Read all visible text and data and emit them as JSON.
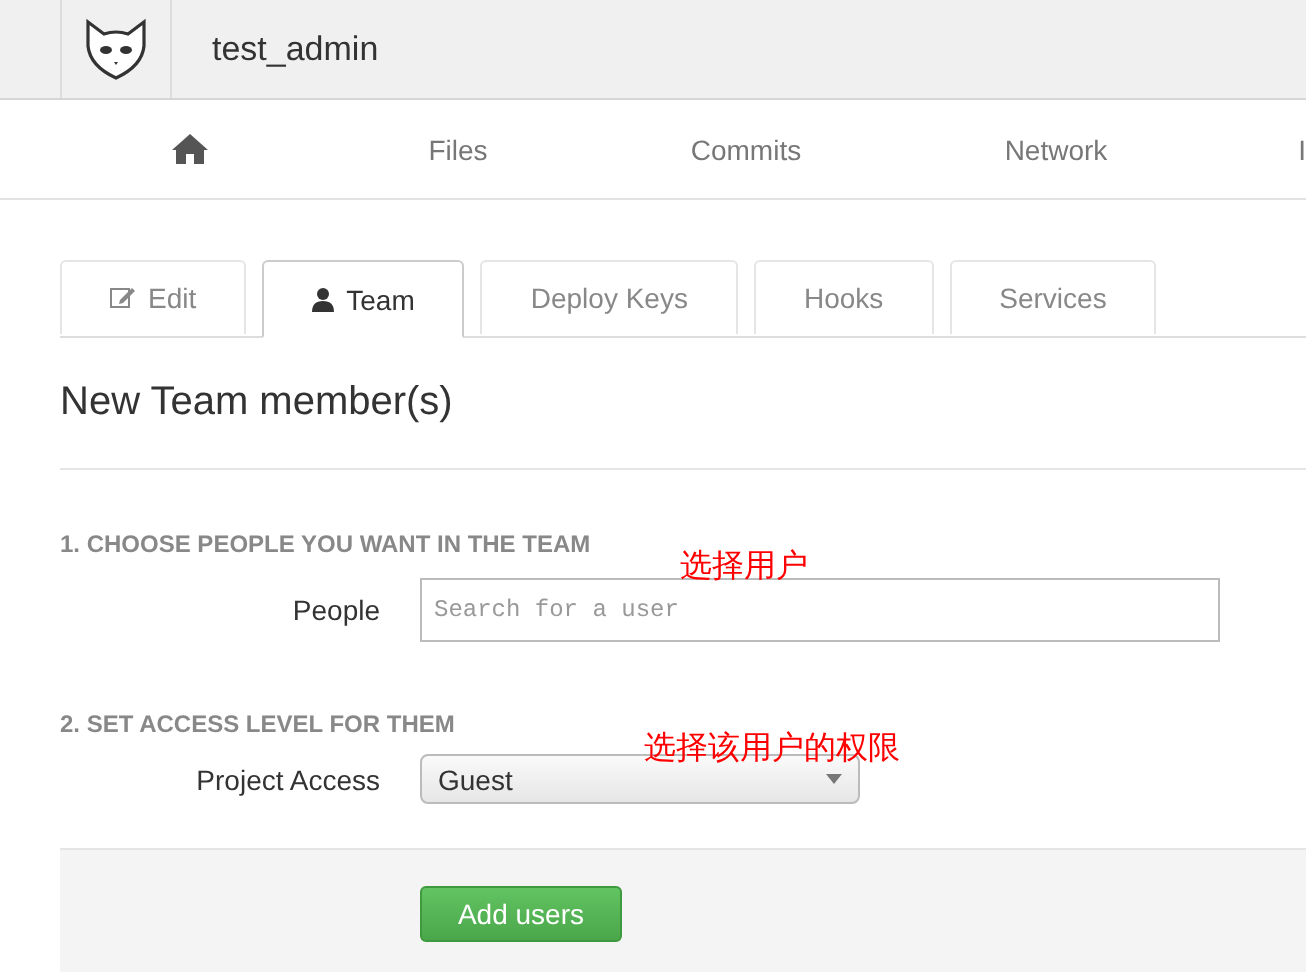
{
  "header": {
    "username": "test_admin"
  },
  "nav": [
    {
      "kind": "home"
    },
    {
      "kind": "text",
      "label": "Files"
    },
    {
      "kind": "text",
      "label": "Commits"
    },
    {
      "kind": "text",
      "label": "Network"
    },
    {
      "kind": "text",
      "label": "I"
    }
  ],
  "tabs": [
    {
      "label": "Edit",
      "kind": "edit",
      "selected": false
    },
    {
      "label": "Team",
      "kind": "user",
      "selected": true
    },
    {
      "label": "Deploy Keys",
      "kind": "plain",
      "selected": false
    },
    {
      "label": "Hooks",
      "kind": "plain",
      "selected": false
    },
    {
      "label": "Services",
      "kind": "plain",
      "selected": false
    }
  ],
  "title": "New Team member(s)",
  "sections": [
    {
      "heading": "1. CHOOSE PEOPLE YOU WANT IN THE TEAM",
      "label": "People",
      "kind": "search",
      "placeholder": "Search for a user"
    },
    {
      "heading": "2. SET ACCESS LEVEL FOR THEM",
      "label": "Project Access",
      "kind": "select",
      "value": "Guest"
    }
  ],
  "annotations": [
    "选择用户",
    "选择该用户的权限"
  ],
  "submit": "Add users"
}
